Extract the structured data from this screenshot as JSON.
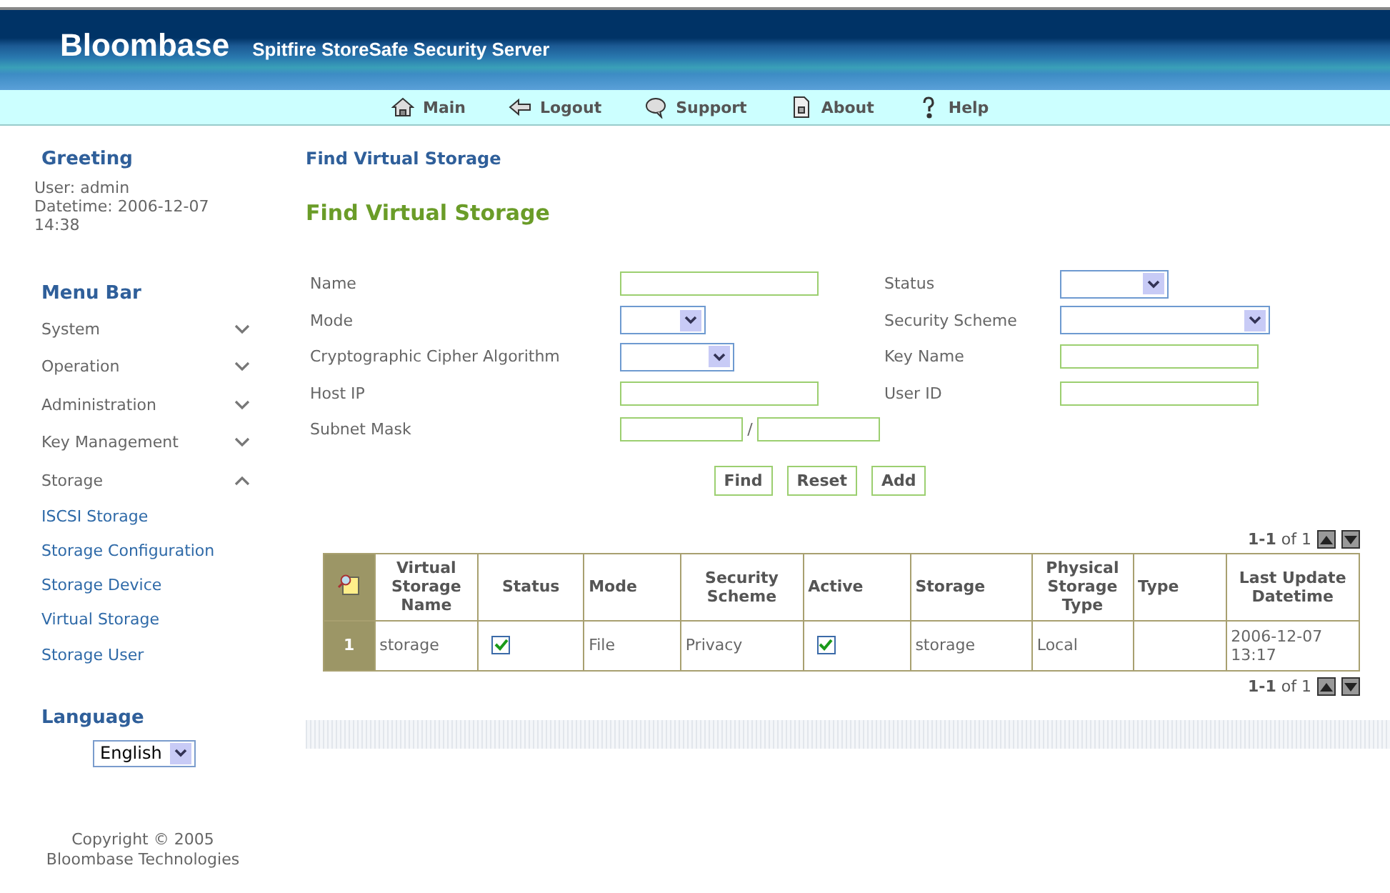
{
  "header": {
    "brand": "Bloombase",
    "product": "Spitfire StoreSafe Security Server"
  },
  "nav": [
    {
      "label": "Main"
    },
    {
      "label": "Logout"
    },
    {
      "label": "Support"
    },
    {
      "label": "About"
    },
    {
      "label": "Help"
    }
  ],
  "sidebar": {
    "greeting_title": "Greeting",
    "user": "User: admin",
    "datetime": "Datetime: 2006-12-07 14:38",
    "menu_title": "Menu Bar",
    "items": [
      {
        "label": "System",
        "expanded": false
      },
      {
        "label": "Operation",
        "expanded": false
      },
      {
        "label": "Administration",
        "expanded": false
      },
      {
        "label": "Key Management",
        "expanded": false
      },
      {
        "label": "Storage",
        "expanded": true,
        "children": [
          {
            "label": "ISCSI Storage"
          },
          {
            "label": "Storage Configuration"
          },
          {
            "label": "Storage Device"
          },
          {
            "label": "Virtual Storage"
          },
          {
            "label": "Storage User"
          }
        ]
      }
    ],
    "language_title": "Language",
    "language": "English",
    "copyright": "Copyright © 2005 Bloombase Technologies"
  },
  "breadcrumb": "Find Virtual Storage",
  "title": "Find Virtual Storage",
  "form": {
    "rows": [
      [
        {
          "label": "Name",
          "kind": "text"
        },
        {
          "label": "Status",
          "kind": "select"
        }
      ],
      [
        {
          "label": "Mode",
          "kind": "select"
        },
        {
          "label": "Security Scheme",
          "kind": "select"
        }
      ],
      [
        {
          "label": "Cryptographic Cipher Algorithm",
          "kind": "select"
        },
        {
          "label": "Key Name",
          "kind": "text"
        }
      ],
      [
        {
          "label": "Host IP",
          "kind": "text"
        },
        {
          "label": "User ID",
          "kind": "text"
        }
      ],
      [
        {
          "label": "Subnet Mask",
          "kind": "pair",
          "separator": "/"
        }
      ]
    ],
    "buttons": [
      "Find",
      "Reset",
      "Add"
    ]
  },
  "pagination": "**1-1** of 1",
  "table": {
    "columns": [
      "Virtual Storage Name",
      "Status",
      "Mode",
      "Security Scheme",
      "Active",
      "Storage",
      "Physical Storage Type",
      "Type",
      "Last Update Datetime"
    ],
    "rows": [
      {
        "index": "1",
        "cells": [
          {
            "kind": "text",
            "text": "storage"
          },
          {
            "kind": "check",
            "checked": true
          },
          {
            "kind": "text",
            "text": "File"
          },
          {
            "kind": "text",
            "text": "Privacy"
          },
          {
            "kind": "check",
            "checked": true
          },
          {
            "kind": "text",
            "text": "storage"
          },
          {
            "kind": "text",
            "text": "Local"
          },
          {
            "kind": "blank"
          },
          {
            "kind": "text",
            "text": "2006-12-07 13:17"
          }
        ]
      }
    ]
  },
  "pagination_bottom": "**1-1** of 1"
}
